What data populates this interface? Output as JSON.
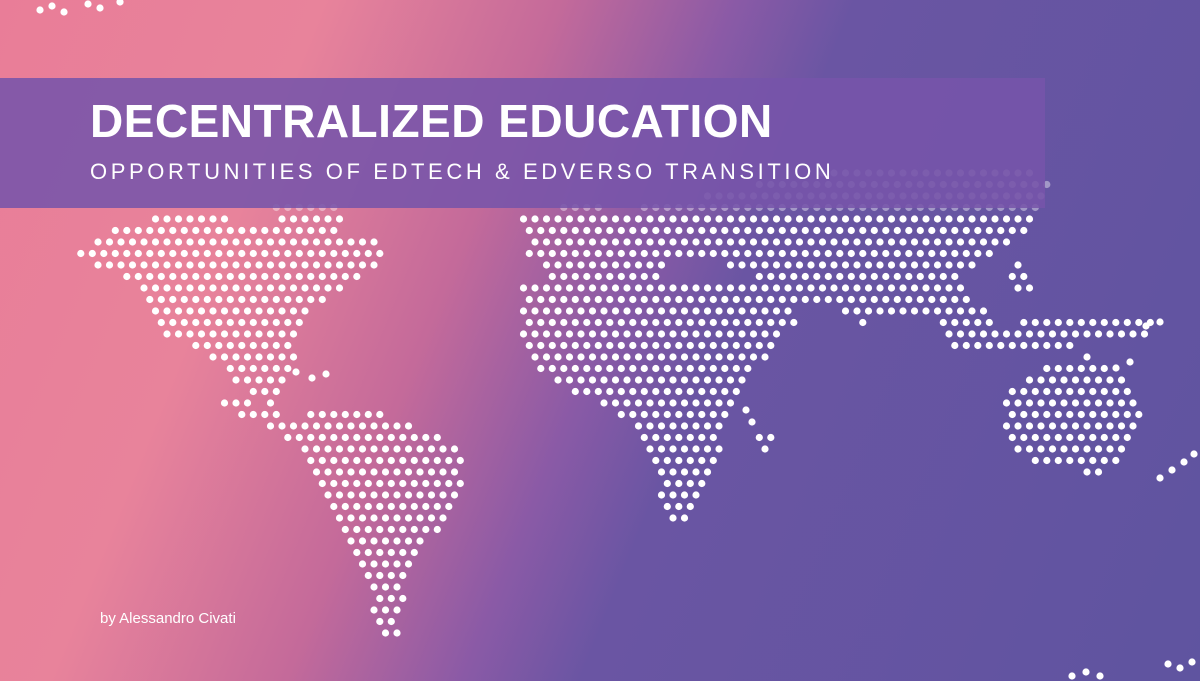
{
  "banner": {
    "title": "DECENTRALIZED EDUCATION",
    "subtitle": "OPPORTUNITIES OF EDTECH & EDVERSO TRANSITION",
    "author": "by Alessandro Civati"
  },
  "colors": {
    "gradient_start": "#e97d98",
    "gradient_end": "#5f54a0",
    "band": "#7654aa",
    "text": "#ffffff",
    "dots": "#ffffff"
  },
  "graphic": "dotted-world-map"
}
